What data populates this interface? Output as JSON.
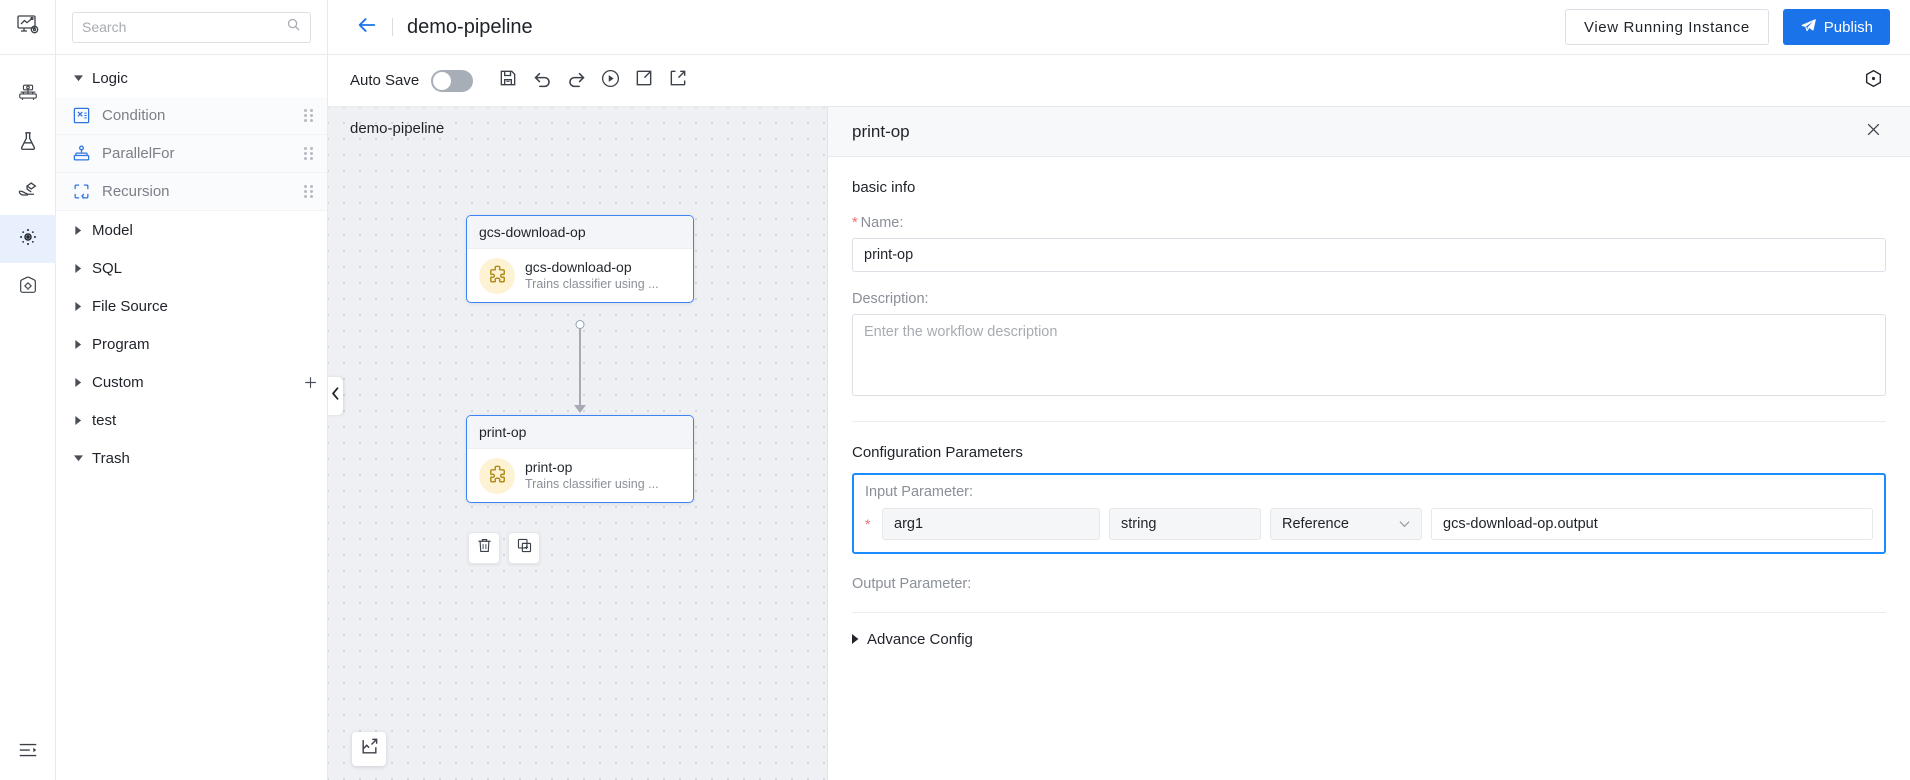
{
  "rail": {
    "logo_icon": "pipeline-monitor-icon",
    "items": [
      {
        "icon": "cluster-icon",
        "name": "rail-item-cluster",
        "active": false
      },
      {
        "icon": "flask-icon",
        "name": "rail-item-experiment",
        "active": false
      },
      {
        "icon": "serving-icon",
        "name": "rail-item-serving",
        "active": false
      },
      {
        "icon": "pipeline-node-icon",
        "name": "rail-item-pipeline",
        "active": true
      },
      {
        "icon": "settings-box-icon",
        "name": "rail-item-settings",
        "active": false
      }
    ],
    "bottom_icon": "menu-collapse-icon"
  },
  "header": {
    "back_icon": "back-arrow-icon",
    "title": "demo-pipeline",
    "view_running_instance": "View Running Instance",
    "publish": "Publish",
    "publish_icon": "send-icon"
  },
  "toolbar": {
    "auto_save_label": "Auto Save",
    "auto_save_on": false,
    "buttons": [
      {
        "name": "save-button",
        "icon": "save-icon"
      },
      {
        "name": "undo-button",
        "icon": "undo-icon"
      },
      {
        "name": "redo-button",
        "icon": "redo-icon"
      },
      {
        "name": "run-button",
        "icon": "play-circle-icon"
      },
      {
        "name": "export-button",
        "icon": "export-icon"
      },
      {
        "name": "import-button",
        "icon": "import-icon"
      }
    ],
    "right_icon": "target-settings-icon"
  },
  "search": {
    "placeholder": "Search",
    "value": "",
    "icon": "search-icon"
  },
  "sidebar": {
    "groups": [
      {
        "label": "Logic",
        "expanded": true,
        "add": false
      },
      {
        "label": "Model",
        "expanded": false,
        "add": false
      },
      {
        "label": "SQL",
        "expanded": false,
        "add": false
      },
      {
        "label": "File Source",
        "expanded": false,
        "add": false
      },
      {
        "label": "Program",
        "expanded": false,
        "add": false
      },
      {
        "label": "Custom",
        "expanded": false,
        "add": true
      },
      {
        "label": "test",
        "expanded": false,
        "add": false
      },
      {
        "label": "Trash",
        "expanded": true,
        "add": false
      }
    ],
    "logic_nodes": [
      {
        "label": "Condition",
        "icon": "condition-icon"
      },
      {
        "label": "ParallelFor",
        "icon": "parallel-for-icon"
      },
      {
        "label": "Recursion",
        "icon": "recursion-icon"
      }
    ]
  },
  "canvas": {
    "title": "demo-pipeline",
    "collapse_icon": "chevron-left-icon",
    "fit_icon": "fit-to-screen-icon",
    "nodes": [
      {
        "header": "gcs-download-op",
        "name": "gcs-download-op",
        "description": "Trains classifier using ...",
        "icon": "puzzle-piece-icon",
        "selected": true
      },
      {
        "header": "print-op",
        "name": "print-op",
        "description": "Trains classifier using ...",
        "icon": "puzzle-piece-icon",
        "selected": true
      }
    ],
    "node_actions": [
      {
        "name": "delete-node-button",
        "icon": "trash-icon"
      },
      {
        "name": "copy-node-button",
        "icon": "copy-icon"
      }
    ]
  },
  "detail": {
    "title": "print-op",
    "close_icon": "close-icon",
    "basic_info_title": "basic info",
    "name_label": "Name:",
    "name_value": "print-op",
    "description_label": "Description:",
    "description_value": "",
    "description_placeholder": "Enter the workflow description",
    "config_title": "Configuration Parameters",
    "input_parameter_label": "Input Parameter:",
    "input_param": {
      "name": "arg1",
      "type": "string",
      "source": "Reference",
      "value": "gcs-download-op.output",
      "dropdown_icon": "chevron-down-icon"
    },
    "output_parameter_label": "Output Parameter:",
    "advance_config_label": "Advance Config",
    "advance_icon": "caret-right-icon"
  },
  "colors": {
    "accent": "#1a73e8",
    "node_border": "#3b82f6",
    "param_highlight": "#1a8cff",
    "required": "#f56c6c",
    "puzzle_bg": "#fdf3d4",
    "puzzle_stroke": "#b08c1a"
  }
}
